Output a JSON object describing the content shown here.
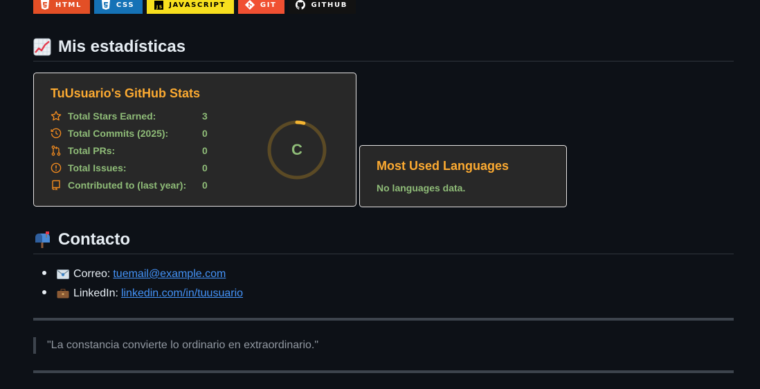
{
  "badges": [
    {
      "label": "HTML",
      "icon": "html5-icon",
      "color": "#e34f26"
    },
    {
      "label": "CSS",
      "icon": "css3-icon",
      "color": "#1572b6"
    },
    {
      "label": "JAVASCRIPT",
      "icon": "javascript-icon",
      "color": "#f7df1e"
    },
    {
      "label": "GIT",
      "icon": "git-icon",
      "color": "#f05032"
    },
    {
      "label": "GITHUB",
      "icon": "github-icon",
      "color": "#121212"
    }
  ],
  "stats_section": {
    "heading": "Mis estadísticas",
    "emoji": "chart-increasing-emoji"
  },
  "stats_card": {
    "title": "TuUsuario's GitHub Stats",
    "rows": [
      {
        "label": "Total Stars Earned:",
        "value": "3",
        "icon": "star-icon"
      },
      {
        "label": "Total Commits (2025):",
        "value": "0",
        "icon": "history-icon"
      },
      {
        "label": "Total PRs:",
        "value": "0",
        "icon": "pull-request-icon"
      },
      {
        "label": "Total Issues:",
        "value": "0",
        "icon": "issue-icon"
      },
      {
        "label": "Contributed to (last year):",
        "value": "0",
        "icon": "repo-icon"
      }
    ],
    "rank": "C",
    "rank_progress": 0.04
  },
  "languages_card": {
    "title": "Most Used Languages",
    "message": "No languages data."
  },
  "contact_section": {
    "heading": "Contacto",
    "emoji": "mailbox-emoji",
    "items": [
      {
        "icon": "envelope-emoji",
        "label": "Correo:",
        "link": "tuemail@example.com"
      },
      {
        "icon": "briefcase-emoji",
        "label": "LinkedIn:",
        "link": "linkedin.com/in/tuusuario"
      }
    ]
  },
  "quote": "\"La constancia convierte lo ordinario en extraordinario.\"",
  "colors": {
    "background": "#0d1117",
    "card_background": "#282828",
    "card_title": "#fcaa31",
    "stat_text": "#8fbc78",
    "icon": "#f08a1f",
    "link": "#4493f8"
  }
}
